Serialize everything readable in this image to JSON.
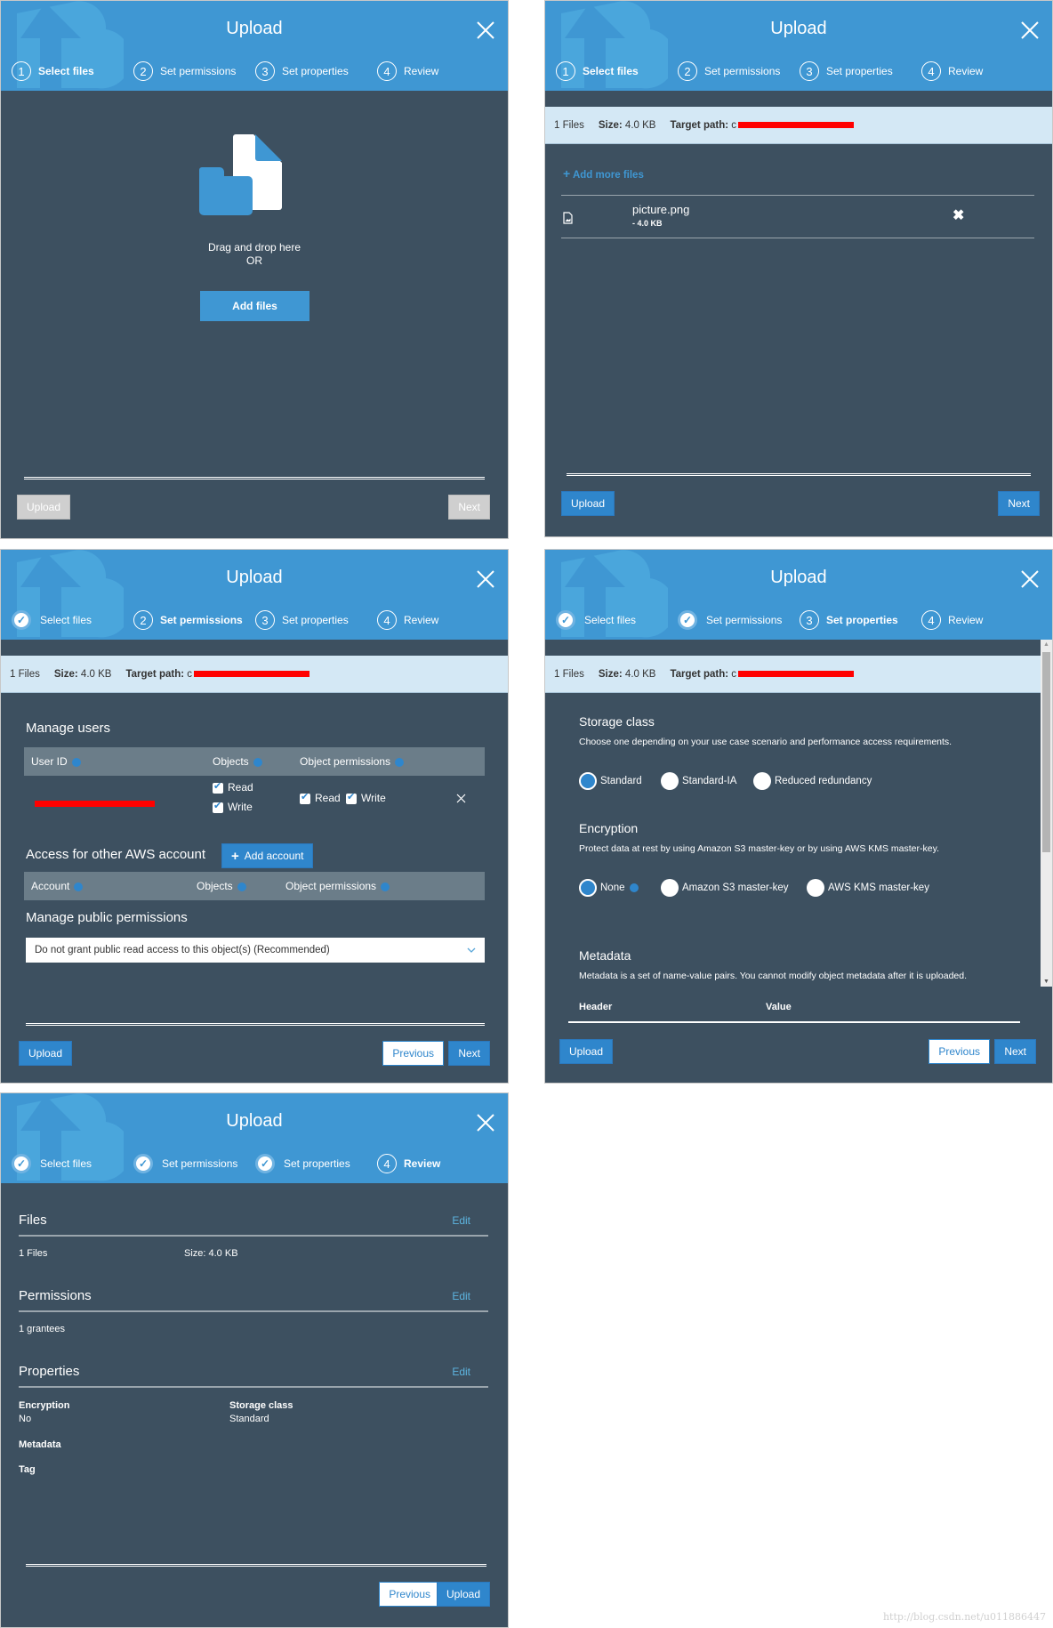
{
  "common": {
    "dialog_title": "Upload",
    "steps": [
      "Select files",
      "Set permissions",
      "Set properties",
      "Review"
    ],
    "step_numbers": [
      "1",
      "2",
      "3",
      "4"
    ],
    "files_count": "1 Files",
    "size_label": "Size:",
    "size_value": "4.0 KB",
    "target_path_label": "Target path:",
    "target_path_visible": "c",
    "upload_label": "Upload",
    "next_label": "Next",
    "previous_label": "Previous",
    "colors": {
      "header": "#3f97d3",
      "body": "#3d5060",
      "primary": "#2f86cc",
      "infobar": "#d4e8f5"
    }
  },
  "panel1": {
    "drag_text": "Drag and drop here",
    "or_text": "OR",
    "add_files_label": "Add files"
  },
  "panel2": {
    "add_more_files_label": "Add more files",
    "file": {
      "name": "picture.png",
      "size": "- 4.0 KB"
    }
  },
  "panel3": {
    "manage_users_title": "Manage users",
    "users_table_headers": [
      "User ID",
      "Objects",
      "Object permissions"
    ],
    "user_row": {
      "objects": [
        "Read",
        "Write"
      ],
      "object_permissions": [
        "Read",
        "Write"
      ]
    },
    "other_account_title": "Access for other AWS account",
    "add_account_label": "Add account",
    "accounts_table_headers": [
      "Account",
      "Objects",
      "Object permissions"
    ],
    "public_title": "Manage public permissions",
    "public_select_value": "Do not grant public read access to this object(s) (Recommended)"
  },
  "panel4": {
    "storage_title": "Storage class",
    "storage_desc": "Choose one depending on your use case scenario and performance access requirements.",
    "storage_options": [
      "Standard",
      "Standard-IA",
      "Reduced redundancy"
    ],
    "storage_selected": "Standard",
    "encryption_title": "Encryption",
    "encryption_desc": "Protect data at rest by using Amazon S3 master-key or by using AWS KMS master-key.",
    "encryption_options": [
      "None",
      "Amazon S3 master-key",
      "AWS KMS master-key"
    ],
    "encryption_selected": "None",
    "metadata_title": "Metadata",
    "metadata_desc": "Metadata is a set of name-value pairs. You cannot modify object metadata after it is uploaded.",
    "metadata_headers": [
      "Header",
      "Value"
    ]
  },
  "panel5": {
    "files_title": "Files",
    "edit_label": "Edit",
    "files_count": "1 Files",
    "files_size": "Size: 4.0 KB",
    "permissions_title": "Permissions",
    "grantees": "1 grantees",
    "properties_title": "Properties",
    "encryption_label": "Encryption",
    "encryption_value": "No",
    "storage_class_label": "Storage class",
    "storage_class_value": "Standard",
    "metadata_label": "Metadata",
    "tag_label": "Tag"
  },
  "watermark": "http://blog.csdn.net/u011886447"
}
